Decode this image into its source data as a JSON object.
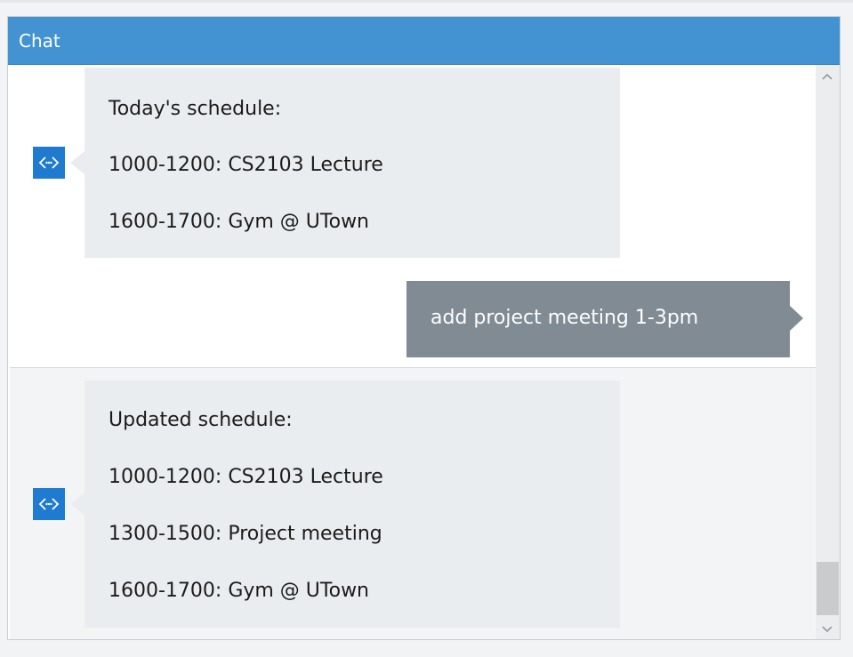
{
  "header": {
    "title": "Chat"
  },
  "colors": {
    "header": "#4392d1",
    "bot_bubble": "#eaedf0",
    "user_bubble": "#808b94",
    "bot_avatar": "#1f7bd0"
  },
  "messages": [
    {
      "sender": "bot",
      "avatar_icon": "bot-icon",
      "lines": [
        "Today's schedule:",
        "1000-1200: CS2103 Lecture",
        "1600-1700: Gym @ UTown"
      ]
    },
    {
      "sender": "user",
      "lines": [
        "add project meeting 1-3pm"
      ]
    },
    {
      "sender": "bot",
      "avatar_icon": "bot-icon",
      "lines": [
        "Updated schedule:",
        "1000-1200: CS2103 Lecture",
        "1300-1500: Project meeting",
        "1600-1700: Gym @ UTown"
      ]
    }
  ],
  "scrollbar": {
    "up_icon": "chevron-up-icon",
    "down_icon": "chevron-down-icon"
  }
}
